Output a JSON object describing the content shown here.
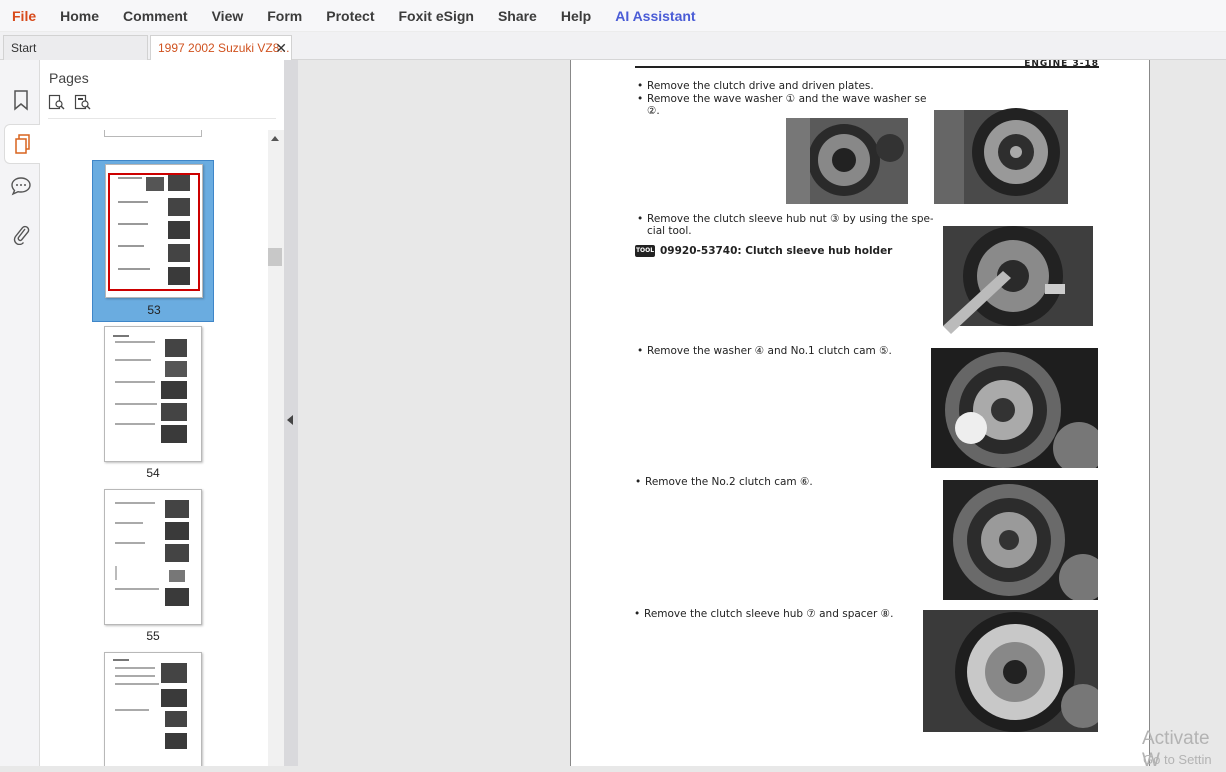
{
  "menubar": {
    "items": [
      "File",
      "Home",
      "Comment",
      "View",
      "Form",
      "Protect",
      "Foxit eSign",
      "Share",
      "Help",
      "AI Assistant"
    ]
  },
  "tabs": {
    "start": "Start",
    "document": "1997 2002 Suzuki VZ8...",
    "close_glyph": "✕"
  },
  "left_rail": {
    "icons": [
      "bookmark-icon",
      "pages-icon",
      "comment-icon",
      "attachment-icon"
    ],
    "active": "pages-icon"
  },
  "pages_panel": {
    "title": "Pages",
    "tools": [
      "page-zoom-in-icon",
      "page-zoom-out-icon"
    ],
    "thumbnails": [
      {
        "number": "53",
        "selected": true
      },
      {
        "number": "54",
        "selected": false
      },
      {
        "number": "55",
        "selected": false
      },
      {
        "number": "",
        "selected": false
      }
    ]
  },
  "document_page": {
    "header": "ENGINE 3-18",
    "steps": [
      {
        "text": "Remove the clutch drive and driven plates."
      },
      {
        "text": "Remove the wave washer ① and the wave washer seat"
      },
      {
        "text": "②."
      },
      {
        "text": "Remove the clutch sleeve hub nut ③ by using the spe-"
      },
      {
        "text": "cial tool."
      },
      {
        "text": "09920-53740: Clutch sleeve hub holder",
        "tool_badge": "TOOL"
      },
      {
        "text": "Remove the washer ④ and No.1 clutch cam ⑤."
      },
      {
        "text": "Remove the No.2 clutch cam ⑥."
      },
      {
        "text": "Remove the clutch sleeve hub ⑦ and spacer ⑧."
      }
    ]
  },
  "watermark": {
    "line1": "Activate W",
    "line2": "Go to Settin"
  },
  "colors": {
    "file_menu": "#d84a1b",
    "ai_menu": "#4a5cd6",
    "active_tab_text": "#d0521f",
    "selected_thumb": "#6aace0",
    "selection_frame": "#cc0000"
  }
}
